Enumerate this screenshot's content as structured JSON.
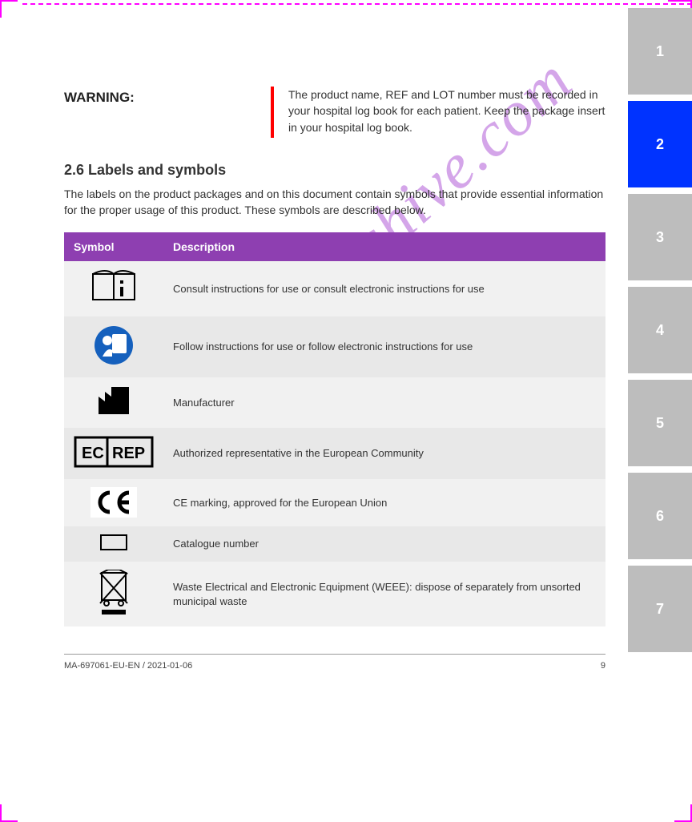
{
  "watermark": "manualshive.com",
  "tabs": [
    "1",
    "2",
    "3",
    "4",
    "5",
    "6",
    "7"
  ],
  "active_tab_index": 1,
  "warning": {
    "label": "WARNING:",
    "body": "The product name, REF and LOT number must be recorded in your hospital log book for each patient. Keep the package insert in your hospital log book."
  },
  "section": {
    "num": "2.6 Labels and symbols",
    "lead": "The labels on the product packages and on this document contain symbols that provide essential information for the proper usage of this product. These symbols are described below."
  },
  "table": {
    "headers": [
      "Symbol",
      "Description"
    ],
    "rows": [
      {
        "icon": "consult-ifu-icon",
        "desc": "Consult instructions for use or consult electronic instructions for use"
      },
      {
        "icon": "follow-ifu-icon",
        "desc": "Follow instructions for use or follow electronic instructions for use"
      },
      {
        "icon": "manufacturer-icon",
        "desc": "Manufacturer"
      },
      {
        "icon": "ec-rep-icon",
        "desc": "Authorized representative in the European Community"
      },
      {
        "icon": "ce-mark-icon",
        "desc": "CE marking, approved for the European Union"
      },
      {
        "icon": "ref-box-icon",
        "desc": "Catalogue number"
      },
      {
        "icon": "weee-icon",
        "desc": "Waste Electrical and Electronic Equipment (WEEE): dispose of separately from unsorted municipal waste"
      }
    ]
  },
  "footer": {
    "left": "MA-697061-EU-EN / 2021-01-06",
    "right": "9"
  }
}
